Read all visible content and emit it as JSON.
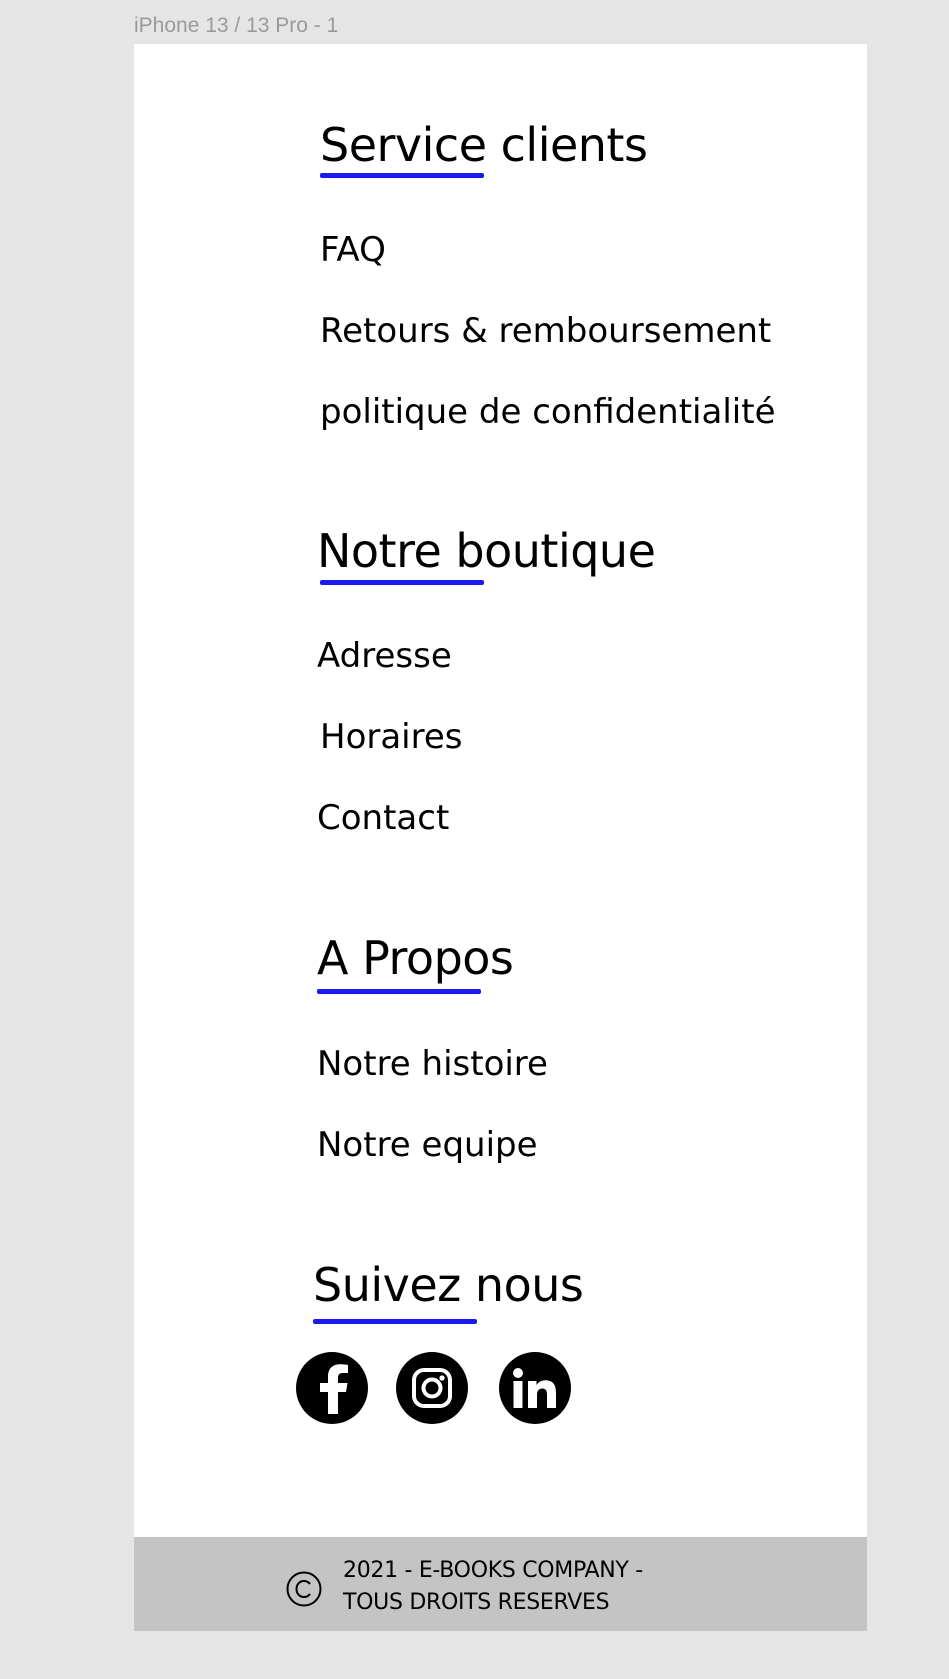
{
  "canvas": {
    "frame_label": "iPhone 13 / 13 Pro - 1"
  },
  "colors": {
    "accent": "#1a1aee",
    "footer_bg": "#c4c4c4",
    "text": "#000000"
  },
  "sections": {
    "service": {
      "title": "Service clients",
      "links": [
        "FAQ",
        "Retours & remboursement",
        "politique de confidentialité"
      ]
    },
    "boutique": {
      "title": "Notre boutique",
      "links": [
        "Adresse",
        "Horaires",
        "Contact"
      ]
    },
    "propos": {
      "title": "A Propos",
      "links": [
        "Notre histoire",
        "Notre equipe"
      ]
    },
    "suivez": {
      "title": "Suivez nous",
      "icons": [
        "facebook-icon",
        "instagram-icon",
        "linkedin-icon"
      ]
    }
  },
  "footer": {
    "copyright_icon": "copyright-icon",
    "line1": "2021 - E-BOOKS COMPANY -",
    "line2": "TOUS DROITS RESERVES"
  }
}
